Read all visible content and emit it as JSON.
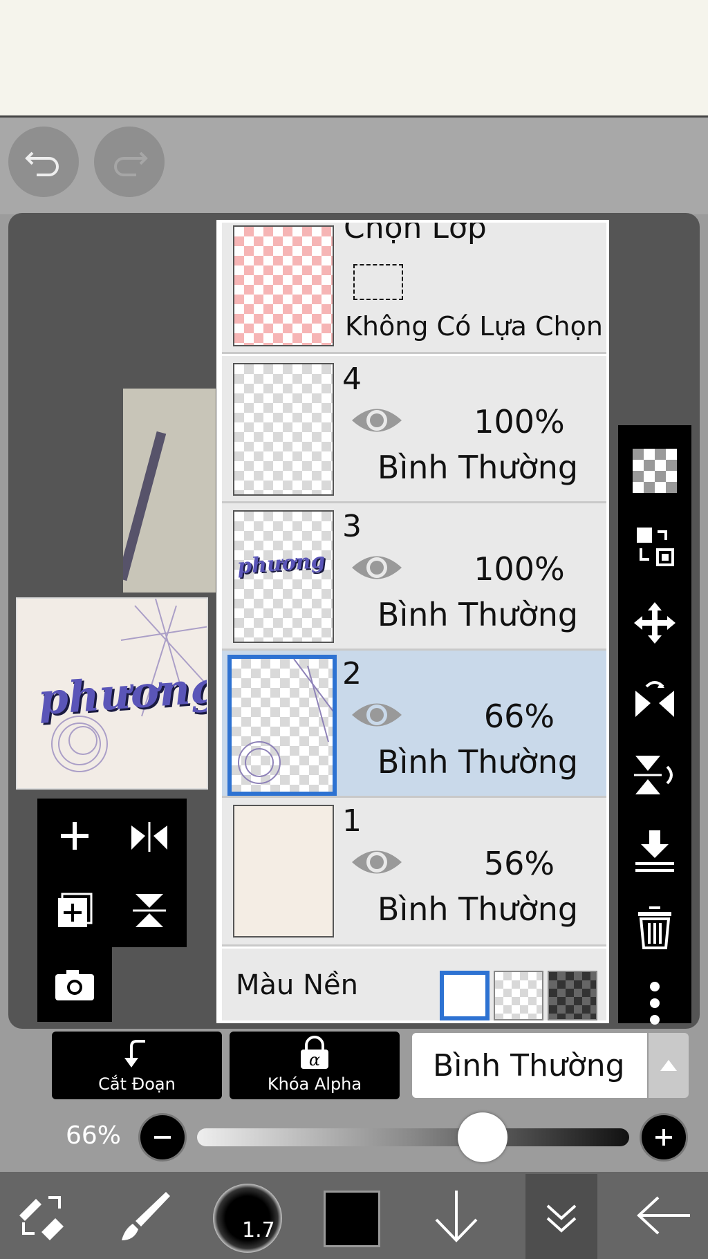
{
  "toolbar": {
    "undo": "undo-icon",
    "redo": "redo-icon"
  },
  "preview": {
    "title_text": "phương"
  },
  "layers": {
    "selection": {
      "title": "Chọn Lớp",
      "status": "Không Có Lựa Chọn"
    },
    "items": [
      {
        "number": "4",
        "opacity": "100%",
        "blend": "Bình Thường"
      },
      {
        "number": "3",
        "opacity": "100%",
        "blend": "Bình Thường"
      },
      {
        "number": "2",
        "opacity": "66%",
        "blend": "Bình Thường"
      },
      {
        "number": "1",
        "opacity": "56%",
        "blend": "Bình Thường"
      }
    ],
    "background_label": "Màu Nền"
  },
  "actions": {
    "clipping": "Cắt Đoạn",
    "alpha_lock": "Khóa Alpha",
    "blend_mode": "Bình Thường"
  },
  "opacity": {
    "label": "66%",
    "value": 0.66
  },
  "bottom": {
    "brush_size": "1.7"
  },
  "colors": {
    "accent": "#2d72d2",
    "selected_layer": "#c9d9ea"
  }
}
